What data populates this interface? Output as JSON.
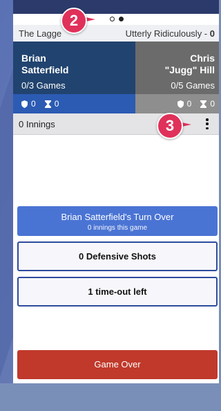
{
  "pager": {
    "count": 2,
    "active": 2
  },
  "league": {
    "name": "The Lagge",
    "opponent": "Utterly Ridiculously -",
    "score": "0"
  },
  "players": {
    "left": {
      "name": "Brian\nSatterfield",
      "games": "0/3 Games",
      "shield": "0",
      "hourglass": "0"
    },
    "right": {
      "name": "Chris\n\"Jugg\" Hill",
      "games": "0/5 Games",
      "shield": "0",
      "hourglass": "0"
    }
  },
  "innings": {
    "label": "0 Innings"
  },
  "buttons": {
    "turn_over": "Brian Satterfield's Turn Over",
    "turn_sub": "0 innings this game",
    "defensive": "0 Defensive Shots",
    "timeout": "1 time-out left",
    "game_over": "Game Over"
  },
  "callouts": {
    "two": "2",
    "three": "3"
  },
  "colors": {
    "accent_blue": "#4a74d4",
    "navy": "#21436f",
    "game_over_red": "#c0392b",
    "callout_pink": "#e0315a"
  }
}
